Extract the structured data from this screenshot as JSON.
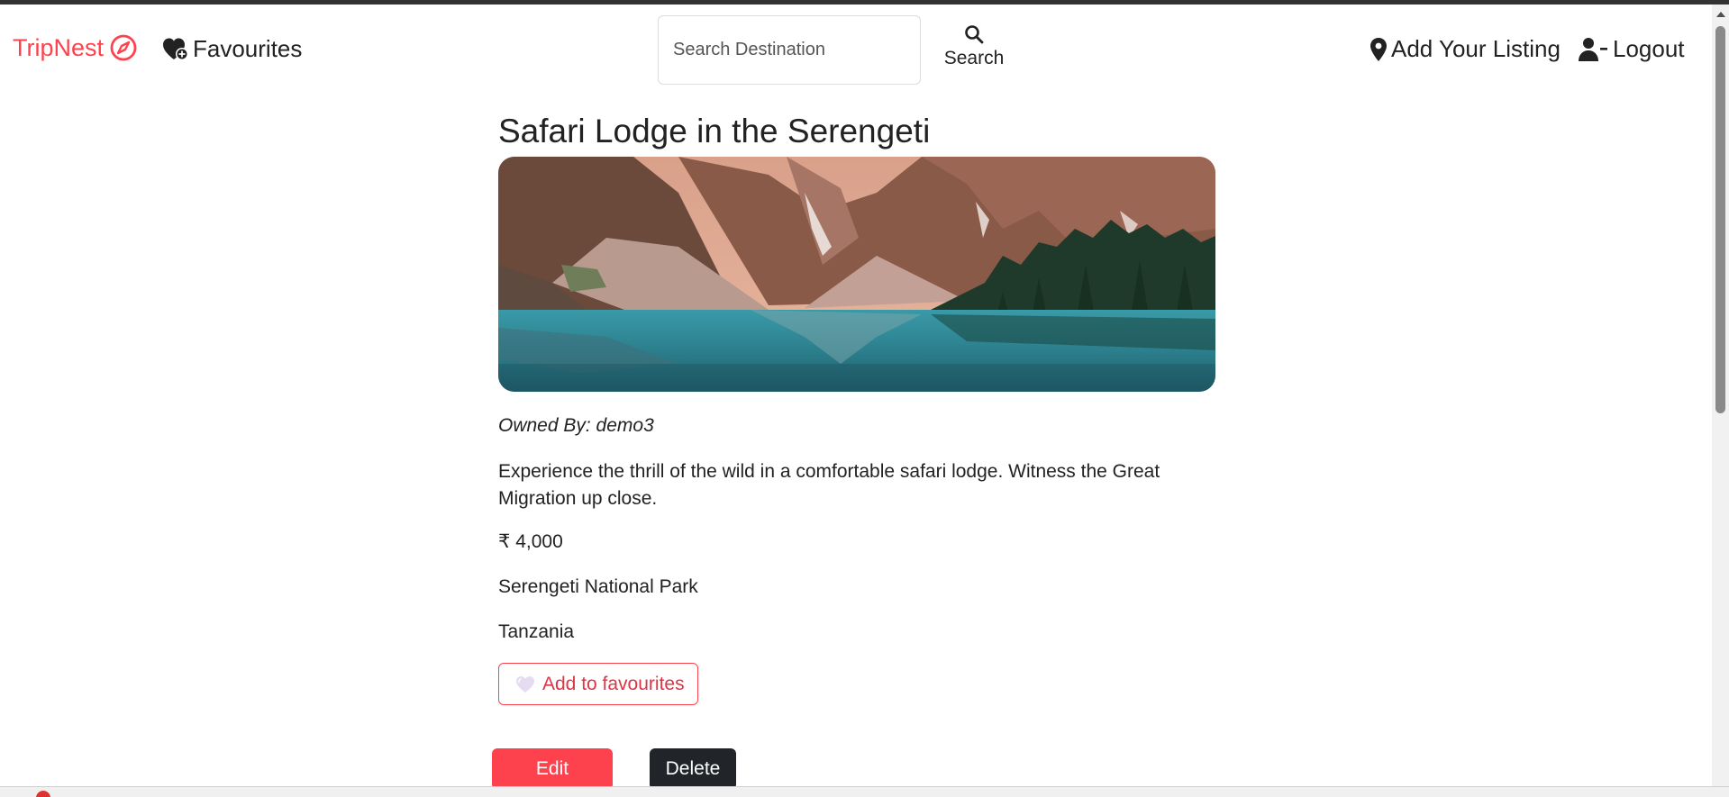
{
  "navbar": {
    "brand": "TripNest",
    "favourites_label": "Favourites",
    "search_placeholder": "Search Destination",
    "search_label": "Search",
    "add_listing_label": "Add Your Listing",
    "logout_label": "Logout"
  },
  "listing": {
    "title": "Safari Lodge in the Serengeti",
    "owner": "Owned By: demo3",
    "description": "Experience the thrill of the wild in a comfortable safari lodge. Witness the Great Migration up close.",
    "price": "₹ 4,000",
    "location": "Serengeti National Park",
    "country": "Tanzania"
  },
  "actions": {
    "add_favourite_label": "Add to favourites",
    "edit_label": "Edit",
    "delete_label": "Delete"
  },
  "icons": {
    "brand": "compass-icon",
    "favourites": "heart-icon",
    "search": "search-icon",
    "add_listing": "map-pin-icon",
    "logout": "user-minus-icon",
    "add_favourite": "heart-icon"
  },
  "colors": {
    "brand": "#fe424d",
    "edit_button": "#fe424d",
    "delete_button": "#212529",
    "favourite_text": "#dc3545"
  }
}
